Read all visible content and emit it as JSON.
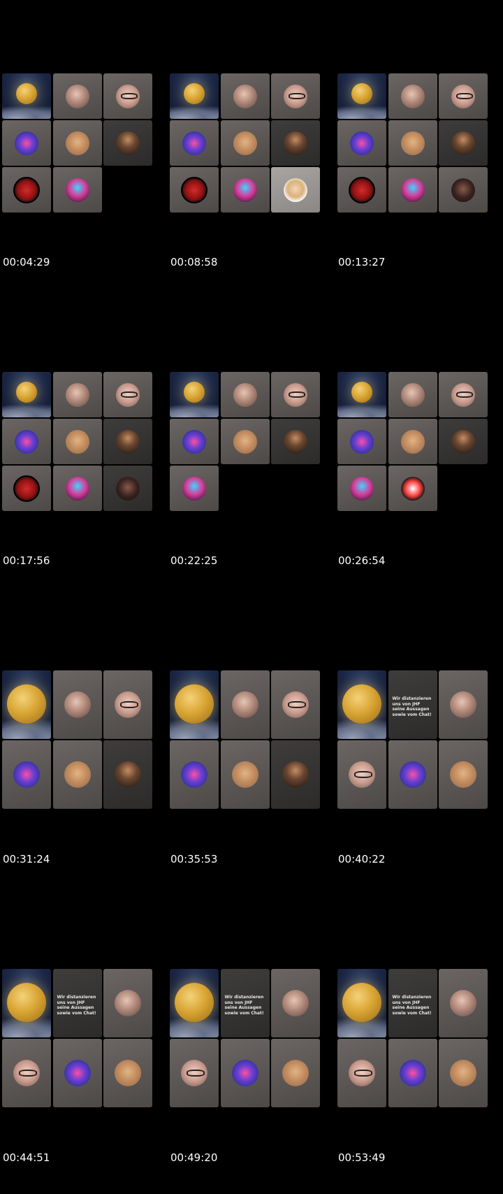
{
  "frames": [
    {
      "timestamp": "00:04:29"
    },
    {
      "timestamp": "00:08:58"
    },
    {
      "timestamp": "00:13:27"
    },
    {
      "timestamp": "00:17:56"
    },
    {
      "timestamp": "00:22:25"
    },
    {
      "timestamp": "00:26:54"
    },
    {
      "timestamp": "00:31:24"
    },
    {
      "timestamp": "00:35:53"
    },
    {
      "timestamp": "00:40:22"
    },
    {
      "timestamp": "00:44:51"
    },
    {
      "timestamp": "00:49:20"
    },
    {
      "timestamp": "00:53:49"
    }
  ],
  "banner_text": "Wir distanzieren uns von JHF seine Aussagen sowie vom Chat!"
}
